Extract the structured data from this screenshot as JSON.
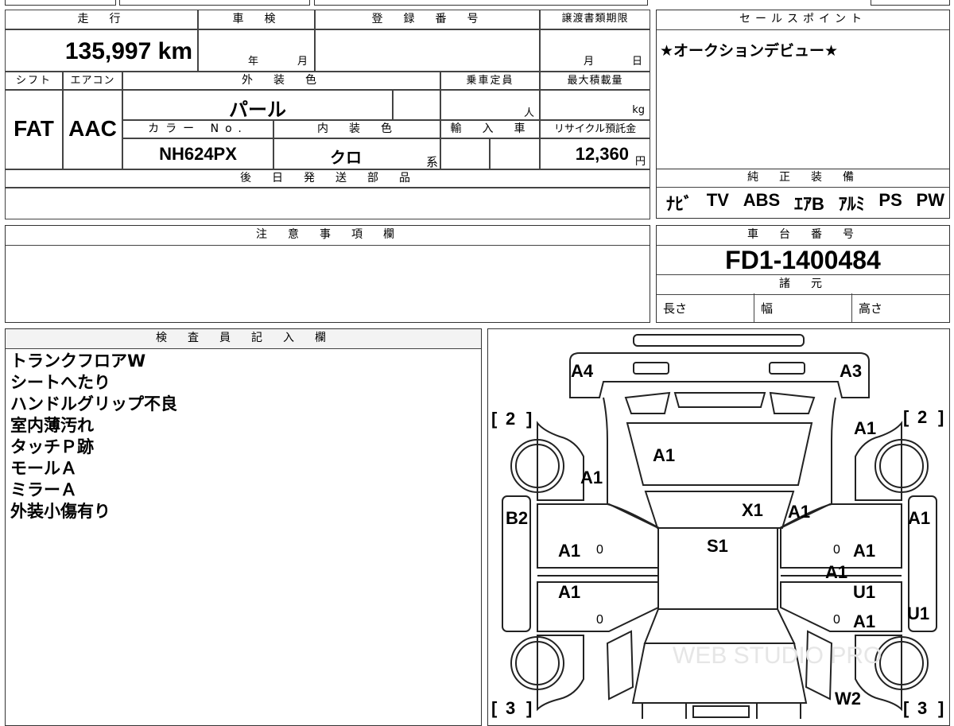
{
  "spec": {
    "mileage_label": "走　行",
    "mileage": "135,997 km",
    "shaken_label": "車　検",
    "shaken_year_unit": "年",
    "shaken_month_unit": "月",
    "registration_label": "登　録　番　号",
    "transfer_deadline_label": "譲渡書類期限",
    "transfer_month_unit": "月",
    "transfer_day_unit": "日",
    "shift_label": "シフト",
    "shift": "FAT",
    "aircon_label": "エアコン",
    "aircon": "AAC",
    "exterior_color_label": "外　装　色",
    "exterior_color": "パール",
    "capacity_label": "乗車定員",
    "capacity_unit": "人",
    "max_load_label": "最大積載量",
    "max_load_unit": "kg",
    "color_no_label": "カラー No.",
    "color_no": "NH624PX",
    "interior_color_label": "内　装　色",
    "interior_color": "クロ",
    "interior_suffix": "系",
    "import_label": "輸　入　車",
    "recycle_label": "リサイクル預託金",
    "recycle_fee": "12,360",
    "recycle_unit": "円",
    "later_parts_label": "後　日　発　送　部　品"
  },
  "sales": {
    "header": "セールスポイント",
    "text": "★オークションデビュー★"
  },
  "equipment": {
    "header": "純　正　装　備",
    "items": [
      "ﾅﾋﾞ",
      "TV",
      "ABS",
      "ｴｱB",
      "ｱﾙﾐ",
      "PS",
      "PW"
    ]
  },
  "notes": {
    "header": "注　意　事　項　欄"
  },
  "chassis": {
    "header": "車　台　番　号",
    "number": "FD1-1400484",
    "dims_header": "諸　元",
    "length_label": "長さ",
    "width_label": "幅",
    "height_label": "高さ"
  },
  "inspector": {
    "header": "検　査　員　記　入　欄",
    "remarks": [
      "トランクフロアW",
      "シートへたり",
      "ハンドルグリップ不良",
      "室内薄汚れ",
      "タッチＰ跡",
      "モールＡ",
      "ミラーＡ",
      "外装小傷有り"
    ]
  },
  "diagram": {
    "marks": {
      "a4": "A4",
      "a3": "A3",
      "a1_rf": "A1",
      "a1_hood": "A1",
      "a1_lf": "A1",
      "x1": "X1",
      "a1_wind": "A1",
      "a1_rside": "A1",
      "b2": "B2",
      "s1": "S1",
      "a1_ld1": "A1",
      "a1_ld2": "A1",
      "a1_rd1": "A1",
      "a1_rd_mid": "A1",
      "u1_rd": "U1",
      "a1_rd2": "A1",
      "u1_rside": "U1",
      "w2": "W2"
    },
    "tires": {
      "front_left": "2",
      "front_right": "2",
      "rear_left": "3",
      "rear_right": "3"
    },
    "door_zero": "0",
    "watermark": "WEB STUDIO PRO"
  }
}
